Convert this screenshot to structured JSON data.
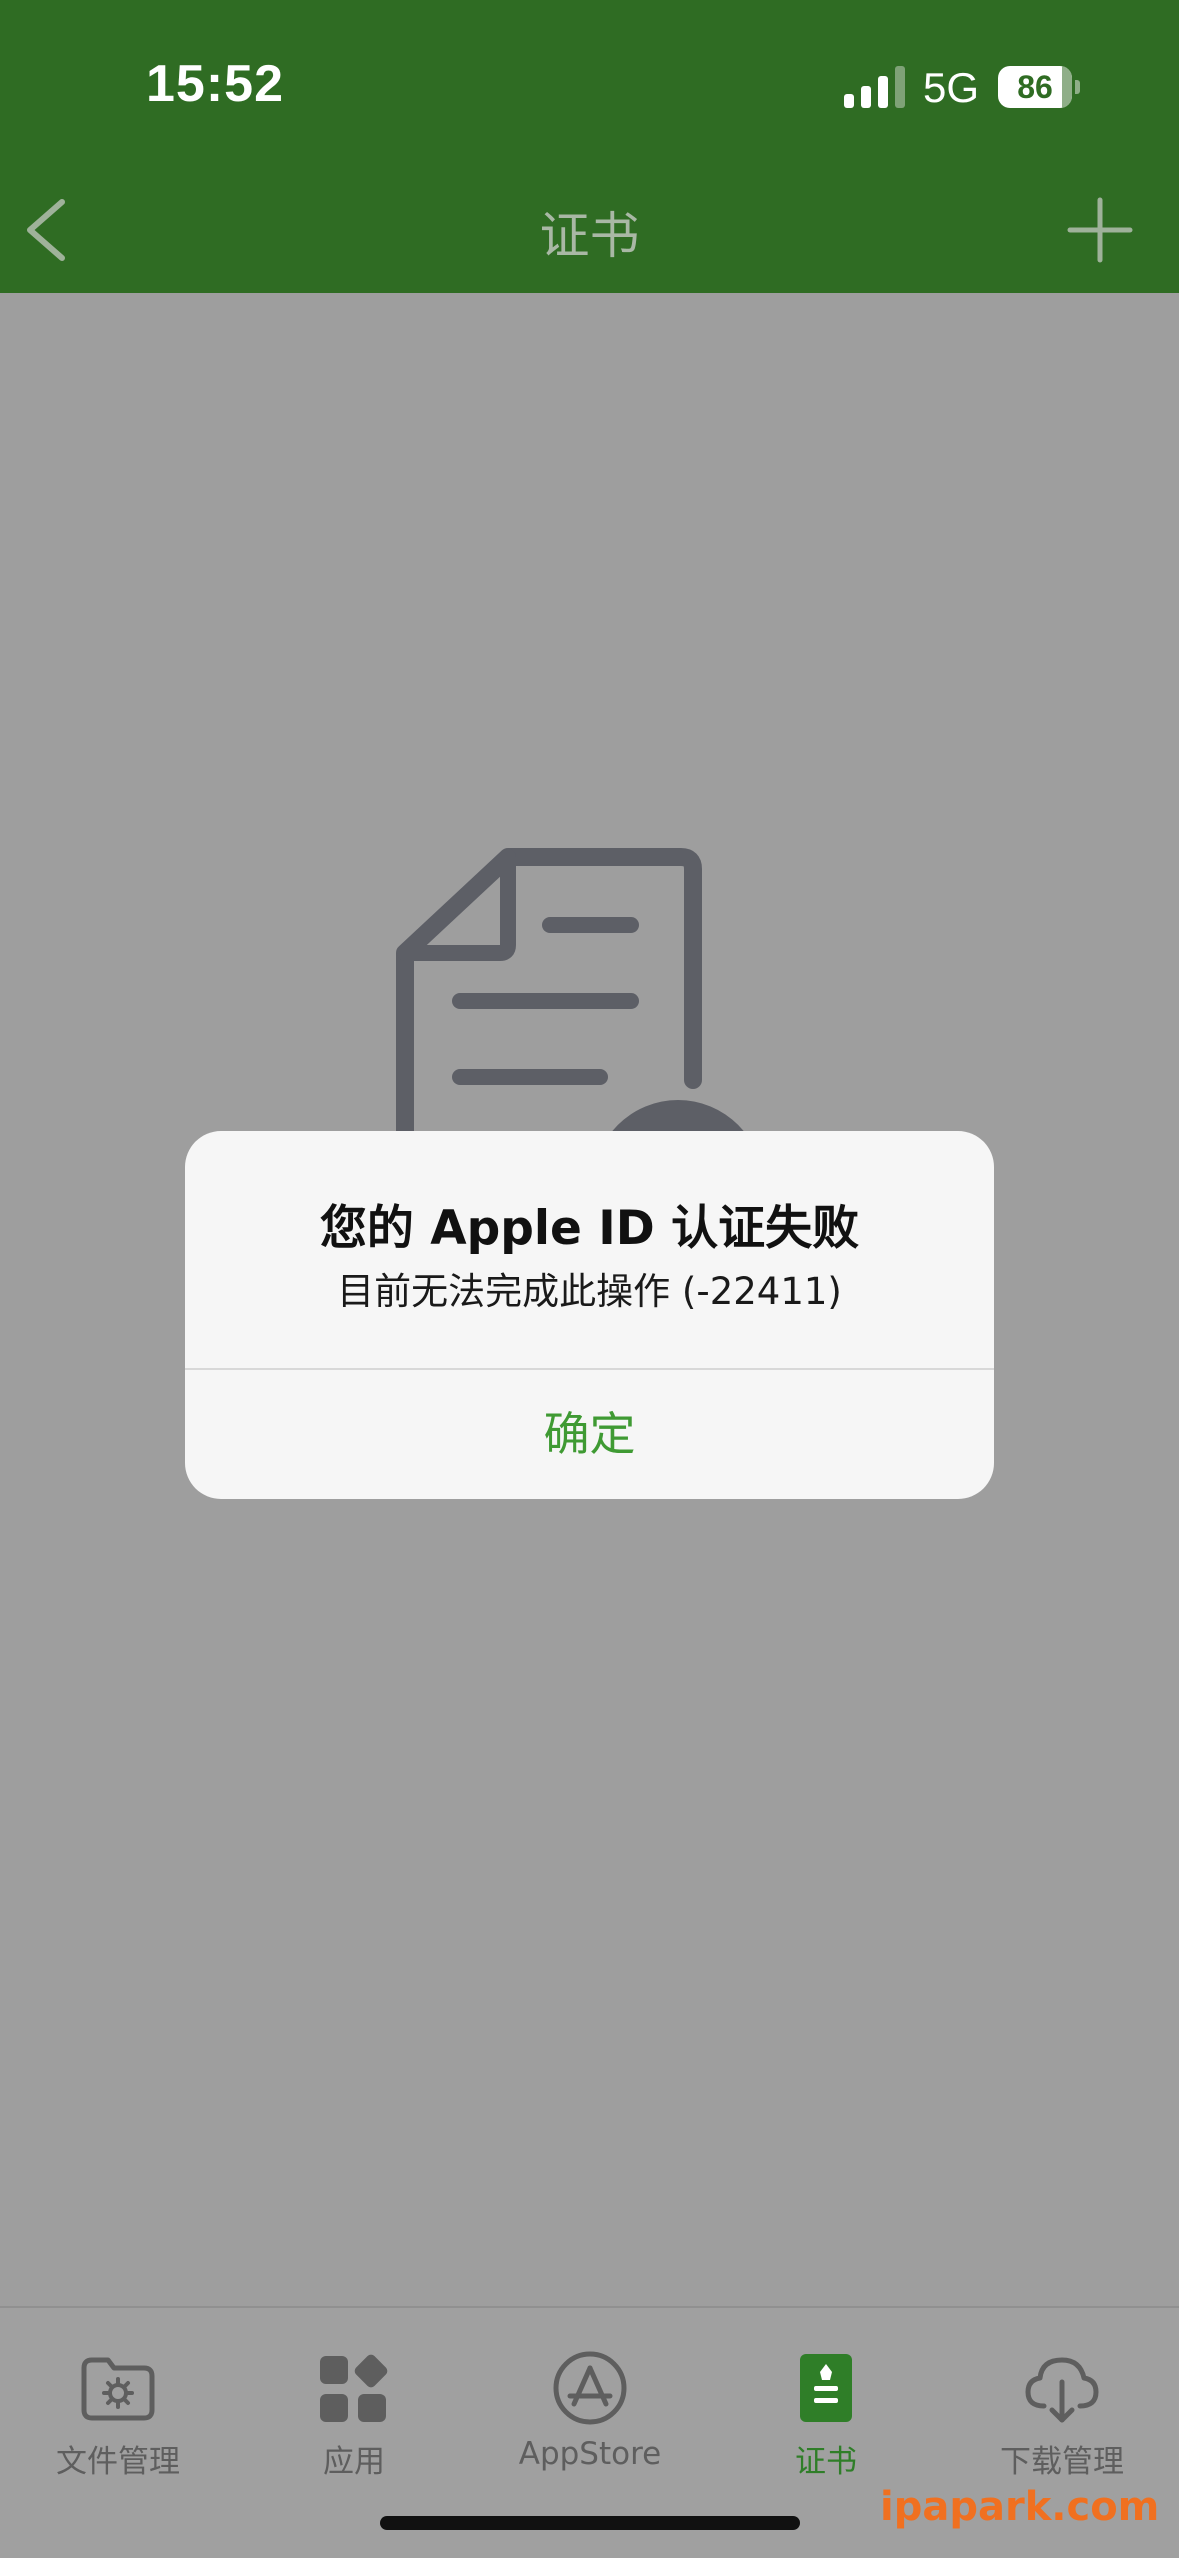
{
  "status_bar": {
    "time": "15:52",
    "network": "5G",
    "battery_level": "86",
    "battery_fraction": 0.86,
    "signal_bars_active": 3,
    "signal_bars_total": 4
  },
  "nav": {
    "title": "证书",
    "back_icon": "chevron-left-icon",
    "add_icon": "plus-icon"
  },
  "empty_state": {
    "icon": "certificate-document-icon"
  },
  "alert": {
    "title": "您的 Apple ID 认证失败",
    "message": "目前无法完成此操作 (-22411)",
    "confirm_label": "确定"
  },
  "tab_bar": {
    "items": [
      {
        "label": "文件管理",
        "icon": "folder-gear-icon",
        "active": false
      },
      {
        "label": "应用",
        "icon": "apps-grid-icon",
        "active": false
      },
      {
        "label": "AppStore",
        "icon": "appstore-icon",
        "active": false
      },
      {
        "label": "证书",
        "icon": "certificate-icon",
        "active": true
      },
      {
        "label": "下载管理",
        "icon": "cloud-download-icon",
        "active": false
      }
    ]
  },
  "watermark": "ipapark.com",
  "colors": {
    "header_green": "#2f6c23",
    "accent_green": "#3f9a33",
    "dim_overlay": "#9e9e9e",
    "watermark_orange": "#f07020"
  }
}
